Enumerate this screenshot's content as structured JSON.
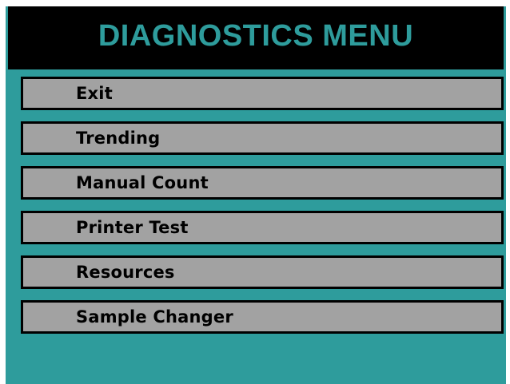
{
  "window": {
    "title": "DIAGNOSTICS MENU"
  },
  "menu": {
    "items": [
      {
        "label": "Exit"
      },
      {
        "label": "Trending"
      },
      {
        "label": "Manual Count"
      },
      {
        "label": "Printer Test"
      },
      {
        "label": "Resources"
      },
      {
        "label": "Sample Changer"
      }
    ]
  },
  "colors": {
    "background": "#2e9c9c",
    "header_background": "#000000",
    "title_text": "#2e9c9c",
    "button_face": "#a2a2a2",
    "button_border": "#000000"
  }
}
